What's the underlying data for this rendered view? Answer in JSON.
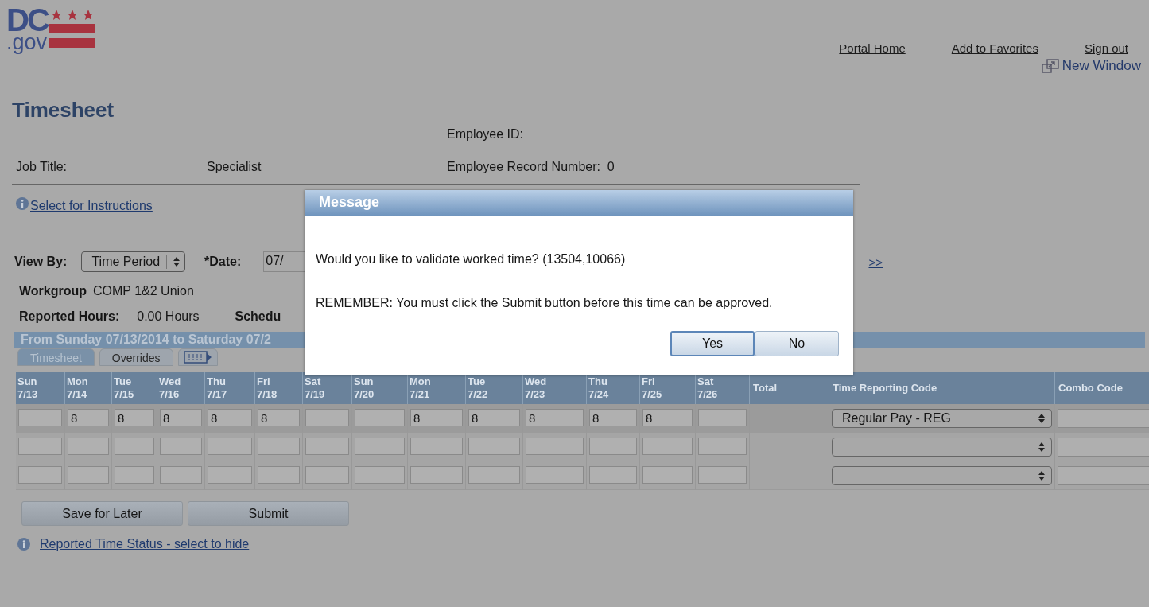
{
  "logo": {
    "line1": "DC",
    "line2": ".gov"
  },
  "header_links": [
    "Portal Home",
    "Add to Favorites",
    "Sign out"
  ],
  "new_window": "New Window",
  "title": "Timesheet",
  "employee_id_label": "Employee ID:",
  "job_title_label": "Job Title:",
  "job_title_value": "Specialist",
  "record_label": "Employee Record Number:",
  "record_value": "0",
  "instructions_link": "Select for Instructions",
  "view_by": {
    "label": "View By:",
    "value": "Time Period"
  },
  "date": {
    "label": "*Date:",
    "value": "07/"
  },
  "next_link": ">>",
  "workgroup": {
    "label": "Workgroup",
    "value": "COMP 1&2 Union"
  },
  "reported_hours": {
    "label": "Reported Hours:",
    "value": "0.00 Hours"
  },
  "scheduled_label": "Schedu",
  "period_band": "From Sunday 07/13/2014 to Saturday 07/2",
  "tabs": [
    {
      "label": "Timesheet",
      "selected": true,
      "kind": "text"
    },
    {
      "label": "Overrides",
      "selected": false,
      "kind": "text"
    },
    {
      "selected": false,
      "kind": "grid"
    }
  ],
  "days": [
    {
      "day": "Sun",
      "date": "7/13"
    },
    {
      "day": "Mon",
      "date": "7/14"
    },
    {
      "day": "Tue",
      "date": "7/15"
    },
    {
      "day": "Wed",
      "date": "7/16"
    },
    {
      "day": "Thu",
      "date": "7/17"
    },
    {
      "day": "Fri",
      "date": "7/18"
    },
    {
      "day": "Sat",
      "date": "7/19"
    },
    {
      "day": "Sun",
      "date": "7/20"
    },
    {
      "day": "Mon",
      "date": "7/21"
    },
    {
      "day": "Tue",
      "date": "7/22"
    },
    {
      "day": "Wed",
      "date": "7/23"
    },
    {
      "day": "Thu",
      "date": "7/24"
    },
    {
      "day": "Fri",
      "date": "7/25"
    },
    {
      "day": "Sat",
      "date": "7/26"
    }
  ],
  "total_header": "Total",
  "trc_header": "Time Reporting Code",
  "combo_header": "Combo Code",
  "rows": [
    {
      "hours": [
        {
          "kind": "empty"
        },
        {
          "kind": "entry",
          "value": "8"
        },
        {
          "kind": "entry",
          "value": "8"
        },
        {
          "kind": "entry",
          "value": "8"
        },
        {
          "kind": "entry",
          "value": "8"
        },
        {
          "kind": "entry",
          "value": "8"
        },
        {
          "kind": "empty"
        },
        {
          "kind": "empty"
        },
        {
          "kind": "entry",
          "value": "8"
        },
        {
          "kind": "entry",
          "value": "8"
        },
        {
          "kind": "entry",
          "value": "8"
        },
        {
          "kind": "entry",
          "value": "8"
        },
        {
          "kind": "entry",
          "value": "8"
        },
        {
          "kind": "empty"
        }
      ],
      "trc": "Regular Pay - REG"
    },
    {
      "hours": [
        {
          "kind": "empty"
        },
        {
          "kind": "empty"
        },
        {
          "kind": "empty"
        },
        {
          "kind": "empty"
        },
        {
          "kind": "empty"
        },
        {
          "kind": "empty"
        },
        {
          "kind": "empty"
        },
        {
          "kind": "empty"
        },
        {
          "kind": "empty"
        },
        {
          "kind": "empty"
        },
        {
          "kind": "empty"
        },
        {
          "kind": "empty"
        },
        {
          "kind": "empty"
        },
        {
          "kind": "empty"
        }
      ]
    },
    {
      "hours": [
        {
          "kind": "empty"
        },
        {
          "kind": "empty"
        },
        {
          "kind": "empty"
        },
        {
          "kind": "empty"
        },
        {
          "kind": "empty"
        },
        {
          "kind": "empty"
        },
        {
          "kind": "empty"
        },
        {
          "kind": "empty"
        },
        {
          "kind": "empty"
        },
        {
          "kind": "empty"
        },
        {
          "kind": "empty"
        },
        {
          "kind": "empty"
        },
        {
          "kind": "empty"
        },
        {
          "kind": "empty"
        }
      ]
    }
  ],
  "buttons": [
    "Save for Later",
    "Submit"
  ],
  "status_link": "Reported Time Status - select to hide",
  "dialog": {
    "title": "Message",
    "question": "Would you like to validate worked time? (13504,10066)",
    "reminder": "REMEMBER:  You must click the Submit button before this time can be approved.",
    "buttons": [
      {
        "label": "Yes",
        "focused": true
      },
      {
        "label": "No",
        "focused": false
      }
    ]
  }
}
